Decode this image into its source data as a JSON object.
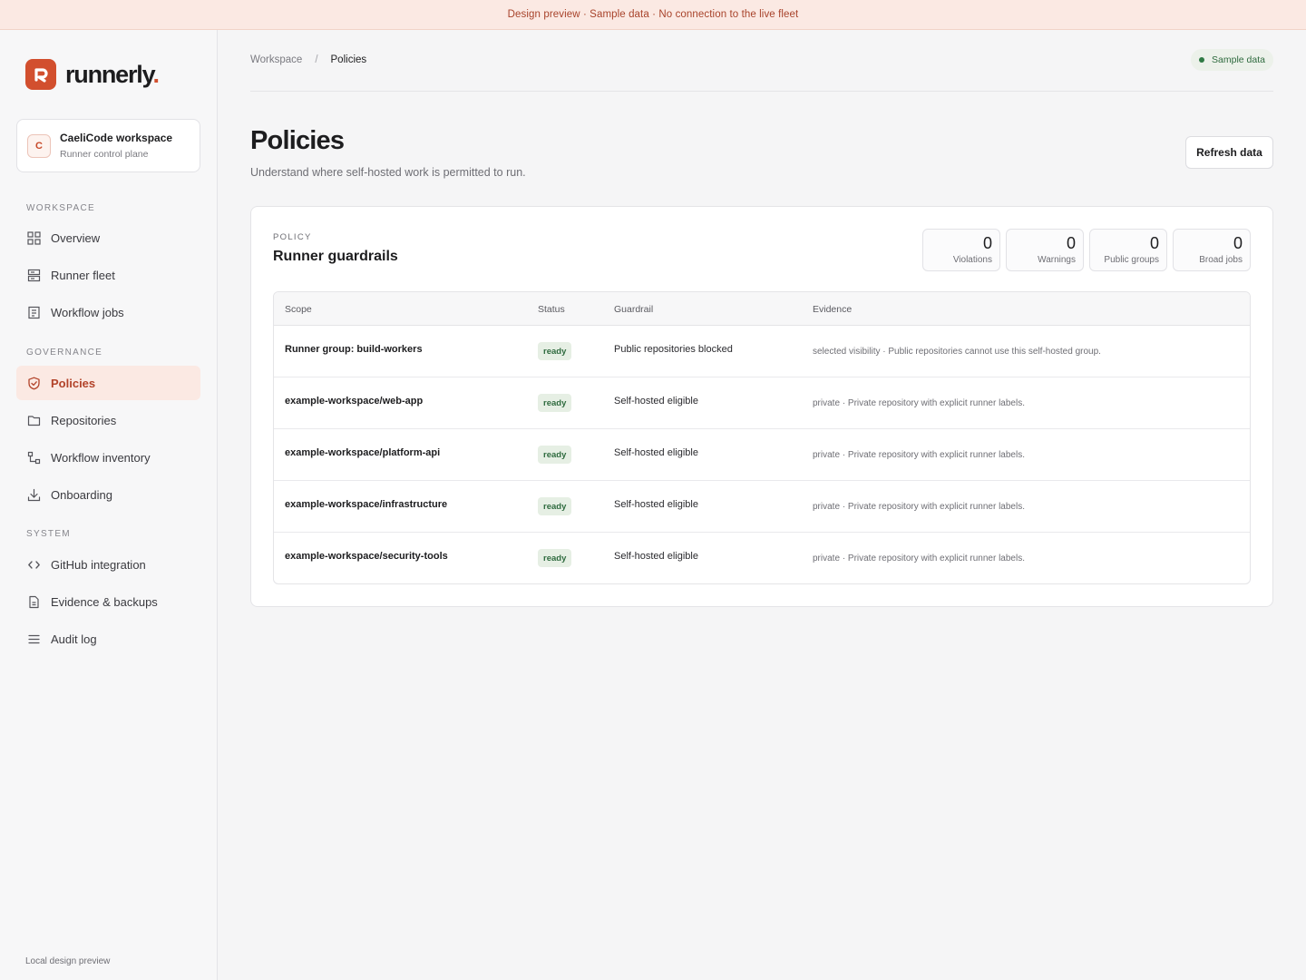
{
  "banner": {
    "text": "Design preview · Sample data · No connection to the live fleet"
  },
  "brand": {
    "name": "runnerly",
    "dot": ".",
    "accent": "#d24f2e"
  },
  "workspace": {
    "initial": "C",
    "name": "CaeliCode workspace",
    "subtitle": "Runner control plane"
  },
  "nav": {
    "sections": [
      {
        "label": "WORKSPACE"
      },
      {
        "label": "GOVERNANCE"
      },
      {
        "label": "SYSTEM"
      }
    ],
    "items": [
      {
        "label": "Overview",
        "icon": "grid-icon"
      },
      {
        "label": "Runner fleet",
        "icon": "server-icon"
      },
      {
        "label": "Workflow jobs",
        "icon": "list-doc-icon"
      },
      {
        "label": "Policies",
        "icon": "shield-check-icon",
        "active": true
      },
      {
        "label": "Repositories",
        "icon": "folder-icon"
      },
      {
        "label": "Workflow inventory",
        "icon": "workflow-icon"
      },
      {
        "label": "Onboarding",
        "icon": "download-icon"
      },
      {
        "label": "GitHub integration",
        "icon": "code-icon"
      },
      {
        "label": "Evidence & backups",
        "icon": "document-icon"
      },
      {
        "label": "Audit log",
        "icon": "menu-lines-icon"
      }
    ]
  },
  "sidebar_footer": "Local design preview",
  "breadcrumb": {
    "parent": "Workspace",
    "separator": "/",
    "current": "Policies"
  },
  "status_pill": {
    "label": "Sample data",
    "color": "#2f7a44"
  },
  "page": {
    "title": "Policies",
    "subtitle": "Understand where self-hosted work is permitted to run.",
    "refresh_label": "Refresh data"
  },
  "card": {
    "eyebrow": "POLICY",
    "title": "Runner guardrails",
    "stats": [
      {
        "value": "0",
        "label": "Violations"
      },
      {
        "value": "0",
        "label": "Warnings"
      },
      {
        "value": "0",
        "label": "Public groups"
      },
      {
        "value": "0",
        "label": "Broad jobs"
      }
    ]
  },
  "table": {
    "columns": [
      "Scope",
      "Status",
      "Guardrail",
      "Evidence"
    ],
    "rows": [
      {
        "scope": "Runner group: build-workers",
        "status": "ready",
        "guardrail": "Public repositories blocked",
        "evidence": "selected visibility · Public repositories cannot use this self-hosted group."
      },
      {
        "scope": "example-workspace/web-app",
        "status": "ready",
        "guardrail": "Self-hosted eligible",
        "evidence": "private · Private repository with explicit runner labels."
      },
      {
        "scope": "example-workspace/platform-api",
        "status": "ready",
        "guardrail": "Self-hosted eligible",
        "evidence": "private · Private repository with explicit runner labels."
      },
      {
        "scope": "example-workspace/infrastructure",
        "status": "ready",
        "guardrail": "Self-hosted eligible",
        "evidence": "private · Private repository with explicit runner labels."
      },
      {
        "scope": "example-workspace/security-tools",
        "status": "ready",
        "guardrail": "Self-hosted eligible",
        "evidence": "private · Private repository with explicit runner labels."
      }
    ]
  }
}
